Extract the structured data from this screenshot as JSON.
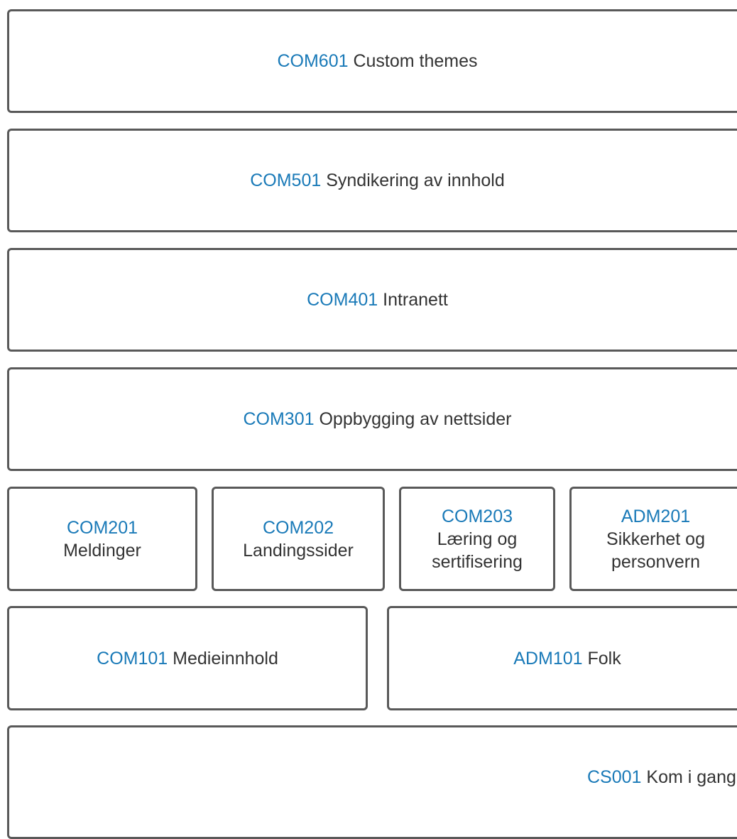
{
  "modules": {
    "com601": {
      "code": "COM601",
      "name": "Custom themes"
    },
    "com501": {
      "code": "COM501",
      "name": "Syndikering av innhold"
    },
    "com401": {
      "code": "COM401",
      "name": "Intranett"
    },
    "com301": {
      "code": "COM301",
      "name": "Oppbygging av nettsider"
    },
    "com201": {
      "code": "COM201",
      "name": "Meldinger"
    },
    "com202": {
      "code": "COM202",
      "name": "Landingssider"
    },
    "com203": {
      "code": "COM203",
      "name_line1": "Læring og",
      "name_line2": "sertifisering"
    },
    "adm201": {
      "code": "ADM201",
      "name_line1": "Sikkerhet og",
      "name_line2": "personvern"
    },
    "com101": {
      "code": "COM101",
      "name": "Medieinnhold"
    },
    "adm101": {
      "code": "ADM101",
      "name": "Folk"
    },
    "cs001": {
      "code": "CS001",
      "name": "Kom i gang"
    }
  },
  "colors": {
    "code": "#1a7ab8",
    "text": "#333333",
    "border": "#595959"
  }
}
